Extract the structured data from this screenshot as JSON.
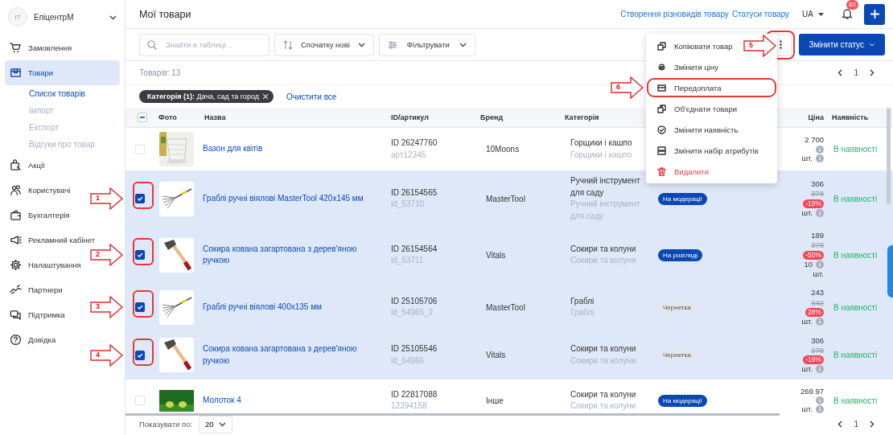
{
  "sidebar": {
    "account": {
      "initials": "IT",
      "name": "ЕпіцентрМ"
    },
    "items": [
      {
        "label": "Замовлення",
        "selected": false
      },
      {
        "label": "Товари",
        "selected": true,
        "children": [
          {
            "label": "Список товарів",
            "selected": true
          },
          {
            "label": "Імпорт",
            "selected": false
          },
          {
            "label": "Експорт",
            "selected": false
          },
          {
            "label": "Відгуки про товар",
            "selected": false
          }
        ]
      },
      {
        "label": "Акції",
        "selected": false
      },
      {
        "label": "Користувачі",
        "selected": false
      },
      {
        "label": "Бухгалтерія",
        "selected": false
      },
      {
        "label": "Рекламний кабінет",
        "selected": false
      },
      {
        "label": "Налаштування",
        "selected": false
      },
      {
        "label": "Партнери",
        "selected": false
      },
      {
        "label": "Підтримка",
        "selected": false
      },
      {
        "label": "Довідка",
        "selected": false
      }
    ]
  },
  "header": {
    "title": "Мої товари",
    "links": [
      "Створення різновидів товару",
      "Статуси товару"
    ],
    "language": "UA",
    "notifications": "82"
  },
  "toolbar": {
    "search": {
      "placeholder": "Знайти в таблиці..."
    },
    "sort": "Спочатку нові",
    "filter": "Фільтрувати",
    "more_button": {
      "highlighted": true,
      "callout": "5"
    },
    "status_button": "Змінити статус"
  },
  "actions_menu": [
    {
      "label": "Копіювати товар",
      "kind": "normal",
      "highlighted": false
    },
    {
      "label": "Змінити ціну",
      "kind": "normal",
      "highlighted": false
    },
    {
      "label": "Передоплата",
      "kind": "normal",
      "highlighted": true,
      "callout": "6"
    },
    {
      "label": "Об'єднати товари",
      "kind": "normal",
      "highlighted": false
    },
    {
      "label": "Змінити наявність",
      "kind": "normal",
      "highlighted": false
    },
    {
      "label": "Змінити набір атрибутів",
      "kind": "normal",
      "highlighted": false
    },
    {
      "label": "Видалити",
      "kind": "danger",
      "highlighted": false
    }
  ],
  "count": "Товарів: 13",
  "pagination": {
    "page": "1"
  },
  "filter_chips": [
    {
      "text": "**Категорія (1):** Дача, сад та город"
    }
  ],
  "clear_filters": "Очистити все",
  "table": {
    "header_checkbox": {
      "indeterminate": true
    },
    "columns": [
      "Фото",
      "Назва",
      "ID/артикул",
      "Бренд",
      "Категорія",
      "Ціна",
      "Наявність"
    ],
    "rows": [
      {
        "selected": false,
        "highlighted": false,
        "name": "Вазон для квітів",
        "id": "ID 26247760",
        "sku": "арт12345",
        "brand": "10Moons",
        "category": "Горщики і кашпо",
        "category_sub": "Горщики і кашпо",
        "price_lines": [
          {
            "kind": "price",
            "text": "2 700"
          },
          {
            "kind": "stock",
            "info": true
          },
          {
            "kind": "stock",
            "text": "шт.",
            "info": true
          }
        ],
        "availability": "В наявності"
      },
      {
        "selected": true,
        "highlighted": true,
        "callout": "1",
        "name": "Граблі ручні віялові MasterTool 420x145 мм",
        "id": "ID 26154565",
        "sku": "id_53710",
        "brand": "MasterTool",
        "category": "Ручний інструмент для саду",
        "category_sub": "Ручний інструмент для саду",
        "status": {
          "text": "На модерації",
          "kind": "active"
        },
        "price_lines": [
          {
            "kind": "price",
            "text": "306"
          },
          {
            "kind": "old",
            "text": "378"
          },
          {
            "kind": "discount",
            "text": "-19%"
          },
          {
            "kind": "stock",
            "text": "шт.",
            "info": true
          }
        ],
        "availability": "В наявності"
      },
      {
        "selected": true,
        "highlighted": true,
        "callout": "2",
        "name": "Сокира кована загартована з дерев'яною ручкою",
        "id": "ID 26154564",
        "sku": "id_53711",
        "brand": "Vitals",
        "category": "Сокири та колуни",
        "category_sub": "Сокири та колуни",
        "status": {
          "text": "На розгляді",
          "kind": "active"
        },
        "price_lines": [
          {
            "kind": "price",
            "text": "189"
          },
          {
            "kind": "old",
            "text": "378"
          },
          {
            "kind": "discount",
            "text": "-50%"
          },
          {
            "kind": "stock",
            "text": "10",
            "info": true
          },
          {
            "kind": "stock",
            "text": "шт.",
            "info": false
          }
        ],
        "availability": "В наявності"
      },
      {
        "selected": true,
        "highlighted": true,
        "callout": "3",
        "name": "Граблі ручні віялові 400x135 мм",
        "id": "ID 25105706",
        "sku": "id_54965_2",
        "brand": "MasterTool",
        "category": "Граблі",
        "category_sub": "Граблі",
        "status": {
          "text": "Чернетка",
          "kind": "draft"
        },
        "price_lines": [
          {
            "kind": "price",
            "text": "243"
          },
          {
            "kind": "old",
            "text": "342"
          },
          {
            "kind": "discount",
            "text": "28%"
          },
          {
            "kind": "stock",
            "text": "шт.",
            "info": true
          }
        ],
        "availability": "В наявності"
      },
      {
        "selected": true,
        "highlighted": true,
        "callout": "4",
        "name": "Сокира кована загартована з дерев'яною ручкою",
        "id": "ID 25105546",
        "sku": "id_54966",
        "brand": "Vitals",
        "category": "Сокири та колуни",
        "category_sub": "Сокири та колуни",
        "status": {
          "text": "Чернетка",
          "kind": "draft"
        },
        "price_lines": [
          {
            "kind": "price",
            "text": "306"
          },
          {
            "kind": "old",
            "text": "378"
          },
          {
            "kind": "discount",
            "text": "-19%"
          },
          {
            "kind": "stock",
            "text": "шт.",
            "info": true
          }
        ],
        "availability": "В наявності"
      },
      {
        "selected": false,
        "highlighted": false,
        "name": "Молоток 4",
        "id": "ID 22817088",
        "sku": "12394158",
        "brand": "Інше",
        "category": "Сокири та колуни",
        "category_sub": "Сокири та колуни",
        "status": {
          "text": "На модерації",
          "kind": "active"
        },
        "price_lines": [
          {
            "kind": "price",
            "text": "269.97"
          },
          {
            "kind": "stock",
            "info": true
          },
          {
            "kind": "stock",
            "text": "шт.",
            "info": true
          }
        ],
        "availability": "В наявності"
      }
    ]
  },
  "footer": {
    "page_size_label": "Показувати по:",
    "page_size": "20",
    "page": "1"
  }
}
